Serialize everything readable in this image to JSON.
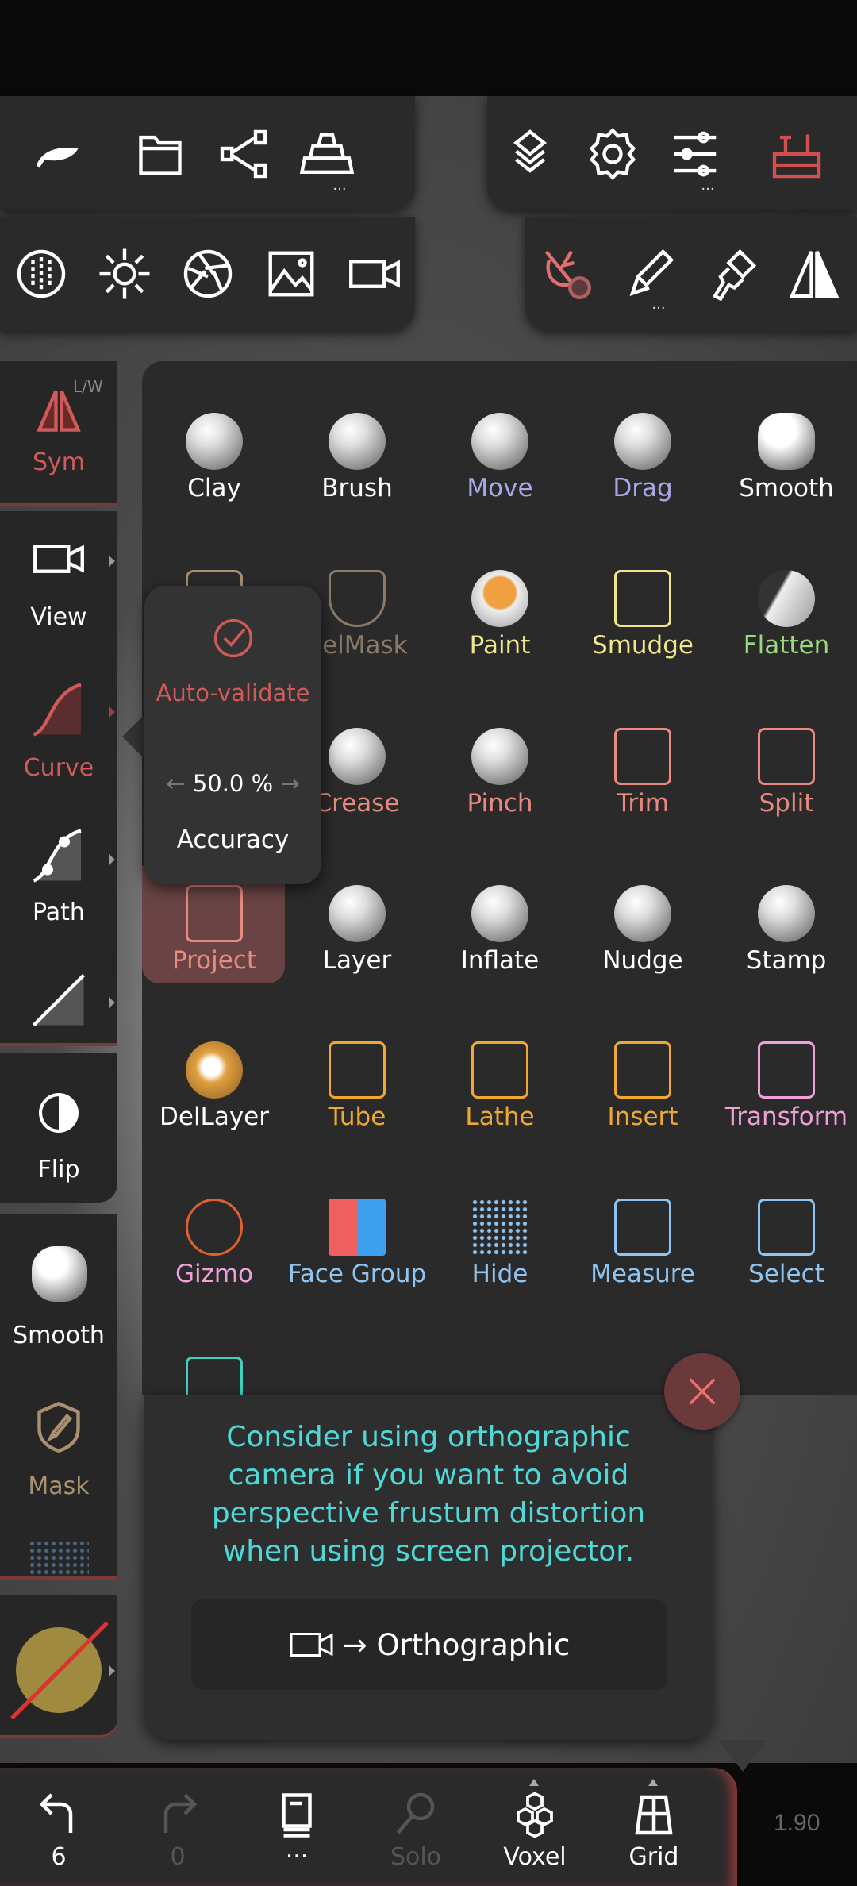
{
  "top_toolbar": {
    "row1_left": [
      {
        "icon": "nomad-logo-icon"
      },
      {
        "icon": "folder-icon"
      },
      {
        "icon": "share-icon"
      },
      {
        "icon": "gold-bars-icon",
        "more": "..."
      }
    ],
    "row1_right": [
      {
        "icon": "layers-icon"
      },
      {
        "icon": "gear-icon"
      },
      {
        "icon": "sliders-icon",
        "more": "..."
      },
      {
        "icon": "toolbox-icon",
        "color": "#d05050"
      }
    ],
    "row2_left": [
      {
        "icon": "matcap-icon"
      },
      {
        "icon": "sun-icon"
      },
      {
        "icon": "aperture-icon"
      },
      {
        "icon": "image-icon"
      },
      {
        "icon": "video-camera-icon"
      }
    ],
    "row2_right": [
      {
        "icon": "project-settings-icon",
        "color": "#e07070"
      },
      {
        "icon": "paint-brush-icon",
        "more": "..."
      },
      {
        "icon": "paint-roller-icon"
      },
      {
        "icon": "symmetry-icon"
      }
    ]
  },
  "sidebar": {
    "sym": {
      "label": "Sym",
      "sub": "L/W"
    },
    "view": {
      "label": "View"
    },
    "curve": {
      "label": "Curve"
    },
    "path": {
      "label": "Path"
    },
    "flip": {
      "label": "Flip"
    },
    "smooth": {
      "label": "Smooth"
    },
    "mask": {
      "label": "Mask"
    }
  },
  "tools": [
    {
      "label": "Clay",
      "color": "#ffffff"
    },
    {
      "label": "Brush",
      "color": "#ffffff"
    },
    {
      "label": "Move",
      "color": "#a8a8e8"
    },
    {
      "label": "Drag",
      "color": "#a8a8e8"
    },
    {
      "label": "Smooth",
      "color": "#ffffff"
    },
    {
      "label": "",
      "color": "#a89070"
    },
    {
      "label": "SelMask",
      "color": "#8a7a68"
    },
    {
      "label": "Paint",
      "color": "#f0e68c"
    },
    {
      "label": "Smudge",
      "color": "#f0e68c"
    },
    {
      "label": "Flatten",
      "color": "#98d880"
    },
    {
      "label": "",
      "color": "#e88a80"
    },
    {
      "label": "Crease",
      "color": "#e88a80"
    },
    {
      "label": "Pinch",
      "color": "#e88a80"
    },
    {
      "label": "Trim",
      "color": "#e88a80"
    },
    {
      "label": "Split",
      "color": "#e88a80"
    },
    {
      "label": "Project",
      "color": "#e88a80"
    },
    {
      "label": "Layer",
      "color": "#ffffff"
    },
    {
      "label": "Inflate",
      "color": "#ffffff"
    },
    {
      "label": "Nudge",
      "color": "#ffffff"
    },
    {
      "label": "Stamp",
      "color": "#ffffff"
    },
    {
      "label": "DelLayer",
      "color": "#ffffff"
    },
    {
      "label": "Tube",
      "color": "#f0a830"
    },
    {
      "label": "Lathe",
      "color": "#f0a830"
    },
    {
      "label": "Insert",
      "color": "#f0a830"
    },
    {
      "label": "Transform",
      "color": "#f0a0d8"
    },
    {
      "label": "Gizmo",
      "color": "#f0a0d8"
    },
    {
      "label": "Face Group",
      "color": "#90c4f0"
    },
    {
      "label": "Hide",
      "color": "#90c4f0"
    },
    {
      "label": "Measure",
      "color": "#90c4f0"
    },
    {
      "label": "Select",
      "color": "#90c4f0"
    },
    {
      "label": "",
      "color": "#40d0c0"
    }
  ],
  "accuracy_popup": {
    "auto_validate": "Auto-validate",
    "value": "50.0 %",
    "label": "Accuracy",
    "left_arrow": "←",
    "right_arrow": "→"
  },
  "tip": {
    "message": "Consider using orthographic camera if you want to avoid perspective frustum distortion when using screen projector.",
    "button": "→ Orthographic",
    "color": "#4fd8d8"
  },
  "bottom_bar": {
    "undo": {
      "label": "6"
    },
    "redo": {
      "label": "0"
    },
    "scene": {
      "label": "..."
    },
    "solo": {
      "label": "Solo"
    },
    "voxel": {
      "label": "Voxel"
    },
    "grid": {
      "label": "Grid"
    }
  },
  "version": "1.90",
  "accent": "#d05a5a"
}
